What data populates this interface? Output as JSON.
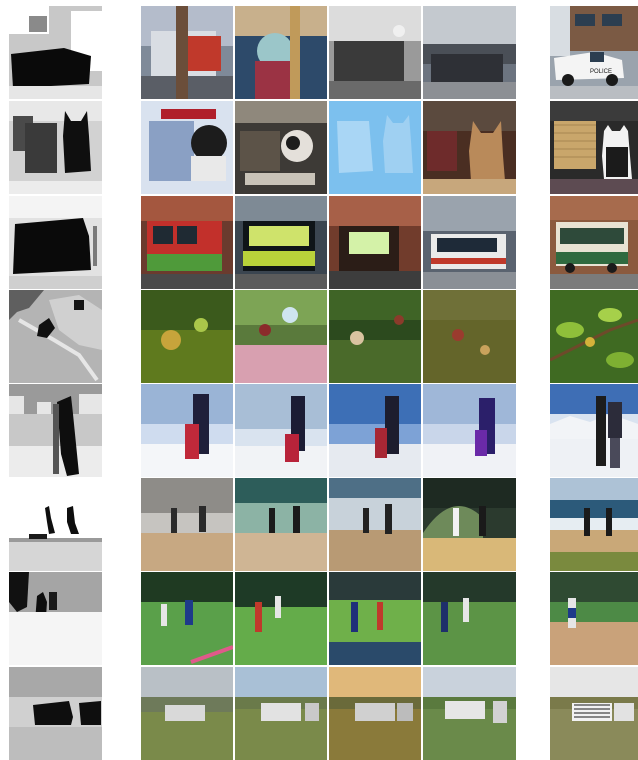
{
  "figure": {
    "columns": [
      "segmentation-mask",
      "generated-1",
      "generated-2",
      "generated-3",
      "generated-4",
      "real-photo"
    ],
    "rows": [
      {
        "scene": "police-truck-street",
        "police_text": "POLICE"
      },
      {
        "scene": "cat-with-luggage"
      },
      {
        "scene": "bus-street"
      },
      {
        "scene": "bird-on-branch"
      },
      {
        "scene": "snowboarder-on-snow"
      },
      {
        "scene": "people-on-beach"
      },
      {
        "scene": "baseball-field"
      },
      {
        "scene": "zebras-on-grassland"
      }
    ],
    "colors": {
      "background": "#ffffff",
      "mask_dark": "#0a0a0a",
      "mask_mid": "#6e6e6e",
      "mask_light": "#c8c8c8",
      "mask_white": "#f2f2f2"
    }
  }
}
